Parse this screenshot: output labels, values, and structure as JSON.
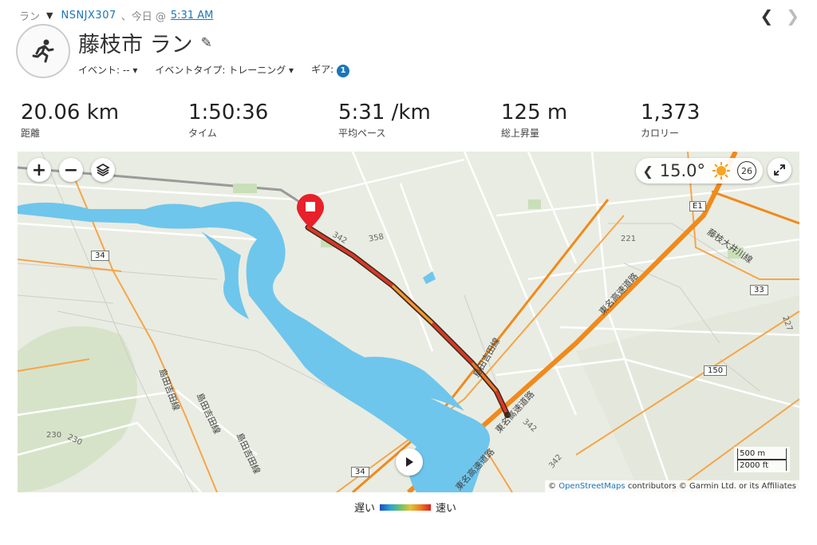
{
  "header": {
    "activity_type": "ラン",
    "device": "NSNJX307",
    "day": "、今日 @",
    "time": "5:31 AM",
    "title": "藤枝市 ラン",
    "event_label": "イベント: --",
    "event_type_label": "イベントタイプ: トレーニング",
    "gear_label": "ギア:",
    "gear_count": "1"
  },
  "stats": [
    {
      "value": "20.06 km",
      "label": "距離"
    },
    {
      "value": "1:50:36",
      "label": "タイム"
    },
    {
      "value": "5:31 /km",
      "label": "平均ペース"
    },
    {
      "value": "125 m",
      "label": "総上昇量"
    },
    {
      "value": "1,373",
      "label": "カロリー"
    }
  ],
  "map": {
    "temperature": "15.0°",
    "wind": "26",
    "scale_metric": "500 m",
    "scale_imperial": "2000 ft",
    "attribution_link": "OpenStreetMaps",
    "attribution_prefix": "©",
    "attribution_rest": "contributors © Garmin Ltd. or its Affiliates",
    "labels": {
      "road_34a": "34",
      "road_34b": "34",
      "road_33": "33",
      "road_150": "150",
      "road_221": "221",
      "road_227": "227",
      "road_342a": "342",
      "road_342b": "342",
      "road_342c": "342",
      "road_358": "358",
      "road_e1": "E1",
      "route_230a": "230",
      "route_230b": "230",
      "tomei_1": "東名高速道路",
      "tomei_2": "東名高速道路",
      "tomei_3": "東名高速道路",
      "shimada_1": "島田吉田線",
      "shimada_2": "島田吉田線",
      "shimada_3": "島田吉田線",
      "shimada_4": "島田吉田線",
      "fujieda": "藤枝大井川線"
    }
  },
  "legend": {
    "slow": "遅い",
    "fast": "速い"
  },
  "colors": {
    "accent": "#1a76b9",
    "river": "#6ec6ec",
    "highway": "#f08a1c",
    "marker": "#e8202a"
  }
}
